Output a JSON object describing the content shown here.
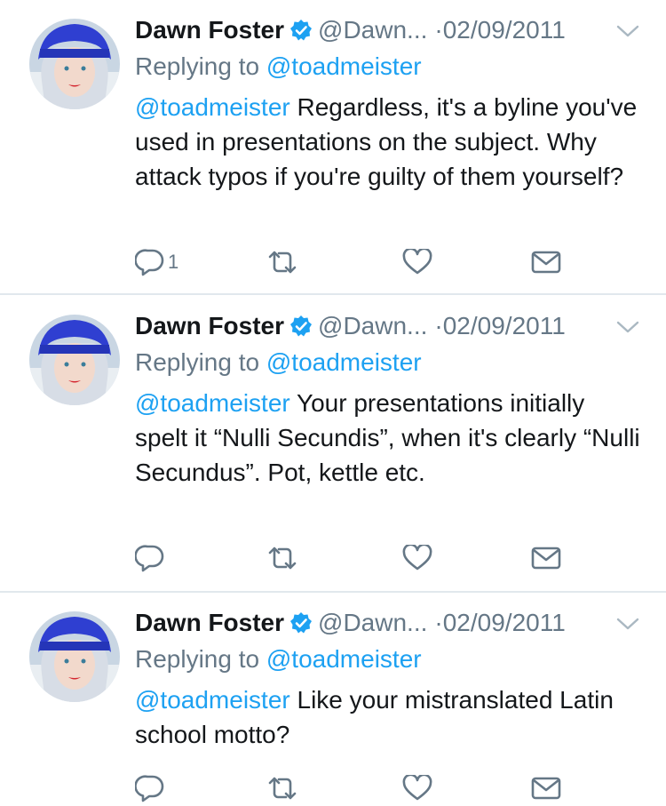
{
  "tweets": [
    {
      "author_name": "Dawn Foster",
      "handle": "@Dawn...",
      "separator": "·",
      "date": "02/09/2011",
      "replying_prefix": "Replying to",
      "replying_to": "@toadmeister",
      "mention": "@toadmeister",
      "body": "Regardless, it's a byline you've used in presentations on the subject. Why attack typos if you're guilty of them yourself?",
      "reply_count": "1"
    },
    {
      "author_name": "Dawn Foster",
      "handle": "@Dawn...",
      "separator": "·",
      "date": "02/09/2011",
      "replying_prefix": "Replying to",
      "replying_to": "@toadmeister",
      "mention": "@toadmeister",
      "body": "Your presentations initially spelt it “Nulli Secundis”, when it's clearly “Nulli Secundus”. Pot, kettle etc.",
      "reply_count": ""
    },
    {
      "author_name": "Dawn Foster",
      "handle": "@Dawn...",
      "separator": "·",
      "date": "02/09/2011",
      "replying_prefix": "Replying to",
      "replying_to": "@toadmeister",
      "mention": "@toadmeister",
      "body": "Like your mistranslated Latin school motto?",
      "reply_count": ""
    }
  ],
  "icons": {
    "verified": "verified-badge-icon",
    "caret": "chevron-down-icon",
    "reply": "reply-icon",
    "retweet": "retweet-icon",
    "like": "heart-icon",
    "dm": "envelope-icon"
  },
  "colors": {
    "link": "#1da1f2",
    "secondary_text": "#657786",
    "primary_text": "#14171a",
    "divider": "#e1e8ed",
    "verified": "#1da1f2"
  }
}
